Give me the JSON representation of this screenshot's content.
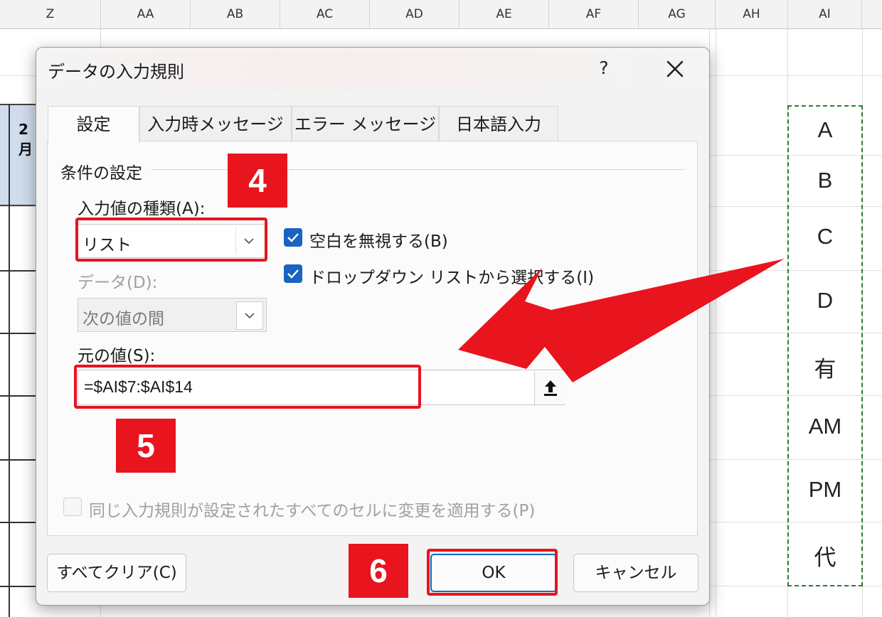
{
  "spreadsheet": {
    "columns": [
      "Z",
      "AA",
      "AB",
      "AC",
      "AD",
      "AE",
      "AF",
      "AG",
      "AH",
      "AI"
    ],
    "cell_fragment": "2月",
    "ai_values": [
      "A",
      "B",
      "C",
      "D",
      "有",
      "AM",
      "PM",
      "代"
    ]
  },
  "dialog": {
    "title": "データの入力規則",
    "help_label": "?",
    "tabs": [
      "設定",
      "入力時メッセージ",
      "エラー メッセージ",
      "日本語入力"
    ],
    "group_label": "条件の設定",
    "allow_label": "入力値の種類(A):",
    "allow_value": "リスト",
    "ignore_blank_label": "空白を無視する(B)",
    "dropdown_label": "ドロップダウン リストから選択する(I)",
    "data_label": "データ(D):",
    "data_value": "次の値の間",
    "source_label": "元の値(S):",
    "source_value": "=$AI$7:$AI$14",
    "apply_all_label": "同じ入力規則が設定されたすべてのセルに変更を適用する(P)",
    "clear_all_label": "すべてクリア(C)",
    "ok_label": "OK",
    "cancel_label": "キャンセル",
    "ignore_blank_checked": true,
    "dropdown_checked": true,
    "apply_all_checked": false
  },
  "annotations": {
    "step4": "4",
    "step5": "5",
    "step6": "6",
    "highlight_color": "#e8141e"
  }
}
